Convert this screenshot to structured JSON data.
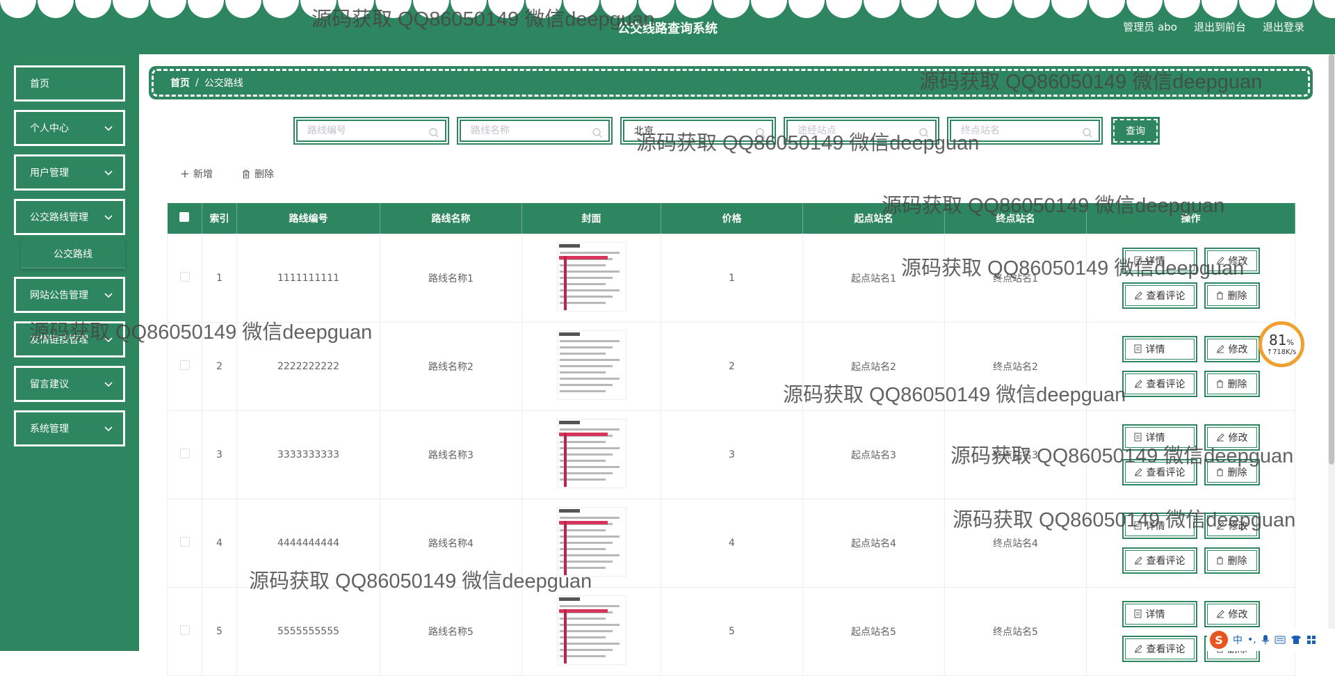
{
  "header": {
    "title": "公交线路查询系统",
    "admin_label": "管理员 abo",
    "to_front": "退出到前台",
    "logout": "退出登录"
  },
  "sidebar": {
    "items": [
      {
        "label": "首页"
      },
      {
        "label": "个人中心"
      },
      {
        "label": "用户管理"
      },
      {
        "label": "公交路线管理"
      },
      {
        "label": "网站公告管理"
      },
      {
        "label": "友情链接管理"
      },
      {
        "label": "留言建议"
      },
      {
        "label": "系统管理"
      }
    ],
    "sub_item": "公交路线"
  },
  "breadcrumb": {
    "home": "首页",
    "sep": "/",
    "current": "公交路线"
  },
  "search": {
    "route_no": {
      "placeholder": "路线编号",
      "value": ""
    },
    "route_name": {
      "placeholder": "路线名称",
      "value": ""
    },
    "third": {
      "placeholder": "",
      "value": "北京"
    },
    "via_station": {
      "placeholder": "途经站点",
      "value": ""
    },
    "end_station": {
      "placeholder": "终点站名",
      "value": ""
    },
    "query_label": "查询"
  },
  "actions": {
    "add": "新增",
    "delete": "删除"
  },
  "table": {
    "columns": [
      "索引",
      "路线编号",
      "路线名称",
      "封面",
      "价格",
      "起点站名",
      "终点站名",
      "操作"
    ],
    "rows": [
      {
        "index": "1",
        "route_no": "1111111111",
        "route_name": "路线名称1",
        "price": "1",
        "start": "起点站名1",
        "end": "终点站名1"
      },
      {
        "index": "2",
        "route_no": "2222222222",
        "route_name": "路线名称2",
        "price": "2",
        "start": "起点站名2",
        "end": "终点站名2"
      },
      {
        "index": "3",
        "route_no": "3333333333",
        "route_name": "路线名称3",
        "price": "3",
        "start": "起点站名3",
        "end": "终点站名3"
      },
      {
        "index": "4",
        "route_no": "4444444444",
        "route_name": "路线名称4",
        "price": "4",
        "start": "起点站名4",
        "end": "终点站名4"
      },
      {
        "index": "5",
        "route_no": "5555555555",
        "route_name": "路线名称5",
        "price": "5",
        "start": "起点站名5",
        "end": "终点站名5"
      }
    ],
    "op_labels": {
      "detail": "详情",
      "edit": "修改",
      "comments": "查看评论",
      "delete": "删除"
    }
  },
  "speed_widget": {
    "percent": "81",
    "unit": "%",
    "rate": "↑718K/s"
  },
  "ime": {
    "logo": "S",
    "mode": "中",
    "punct": "•,"
  },
  "watermark": "源码获取 QQ86050149 微信deepguan",
  "colors": {
    "primary": "#2e8660",
    "speed_ring": "#f0a030",
    "ime_logo": "#e8541e"
  }
}
